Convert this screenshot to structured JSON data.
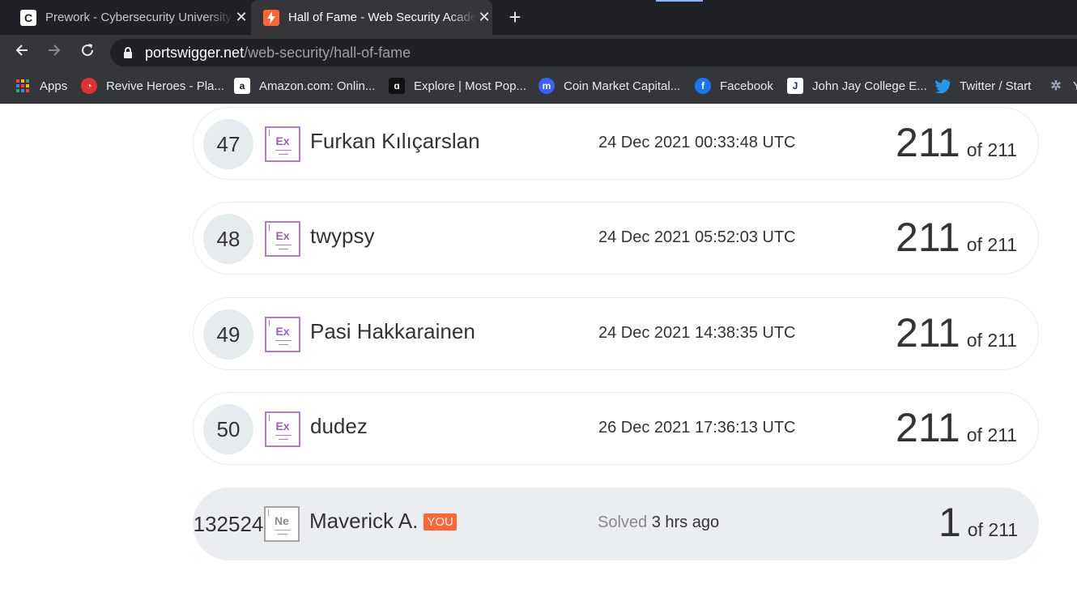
{
  "tabs": [
    {
      "title": "Prework - Cybersecurity University",
      "favicon": "C",
      "active": false
    },
    {
      "title": "Hall of Fame - Web Security Academy",
      "favicon": "lightning-icon",
      "active": true
    }
  ],
  "address": {
    "host": "portswigger.net",
    "path": "/web-security/hall-of-fame"
  },
  "bookmarks": [
    {
      "label": "Apps",
      "icon": "apps-grid-icon"
    },
    {
      "label": "Revive Heroes - Pla...",
      "icon": "revive-heroes-icon"
    },
    {
      "label": "Amazon.com: Onlin...",
      "icon": "amazon-icon"
    },
    {
      "label": "Explore | Most Pop...",
      "icon": "explore-icon"
    },
    {
      "label": "Coin Market Capital...",
      "icon": "coinmarketcap-icon"
    },
    {
      "label": "Facebook",
      "icon": "facebook-icon"
    },
    {
      "label": "John Jay College E...",
      "icon": "john-jay-icon"
    },
    {
      "label": "Twitter / Start",
      "icon": "twitter-icon"
    },
    {
      "label": "Y",
      "icon": "tree-icon"
    }
  ],
  "leaderboard": {
    "rows": [
      {
        "rank": "47",
        "level": "Ex",
        "name": "Furkan Kılıçarslan",
        "time": "24 Dec 2021 00:33:48 UTC",
        "solved": "211",
        "total": "of 211"
      },
      {
        "rank": "48",
        "level": "Ex",
        "name": "twypsy",
        "time": "24 Dec 2021 05:52:03 UTC",
        "solved": "211",
        "total": "of 211"
      },
      {
        "rank": "49",
        "level": "Ex",
        "name": "Pasi Hakkarainen",
        "time": "24 Dec 2021 14:38:35 UTC",
        "solved": "211",
        "total": "of 211"
      },
      {
        "rank": "50",
        "level": "Ex",
        "name": "dudez",
        "time": "26 Dec 2021 17:36:13 UTC",
        "solved": "211",
        "total": "of 211"
      }
    ],
    "you": {
      "rank": "132524",
      "level": "Ne",
      "name": "Maverick A.",
      "badge": "YOU",
      "time_prefix": "Solved",
      "time": "3 hrs ago",
      "solved": "1",
      "total": "of 211"
    }
  },
  "colors": {
    "accent": "#ff6633",
    "expert_level": "#b07cc6",
    "newbie_level": "#a4a4a4"
  }
}
